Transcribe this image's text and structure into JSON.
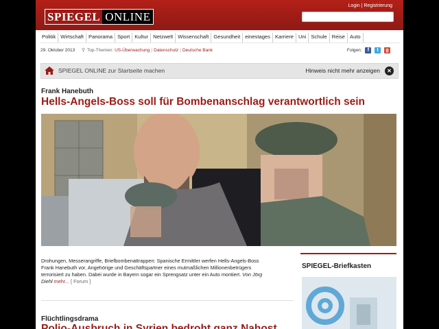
{
  "header": {
    "logo_part1": "SPIEGEL",
    "logo_part2": "ONLINE",
    "login": "Login",
    "register": "Registrierung",
    "brand_color": "#9b1b17"
  },
  "nav": {
    "items": [
      "Politik",
      "Wirtschaft",
      "Panorama",
      "Sport",
      "Kultur",
      "Netzwelt",
      "Wissenschaft",
      "Gesundheit",
      "einestages",
      "Karriere",
      "Uni",
      "Schule",
      "Reise",
      "Auto"
    ]
  },
  "datebar": {
    "date": "29. Oktober 2013",
    "top_label": "Top-Themen:",
    "topics": [
      "US-Überwachung",
      "Datenschutz",
      "Deutsche Bank"
    ],
    "follow_label": "Folgen:"
  },
  "startbar": {
    "text": "SPIEGEL ONLINE zur Startseite machen",
    "hint": "Hinweis nicht mehr anzeigen"
  },
  "article": {
    "kicker": "Frank Hanebuth",
    "headline": "Hells-Angels-Boss soll für Bombenanschlag verantwortlich sein",
    "teaser_line1": "Drohungen, Messerangriffe, Briefbombenattrappen: Spanische Ermittler werfen Hells-Angels-Boss",
    "teaser_line2": "Frank Hanebuth vor, Angehörige und Geschäftspartner eines mutmaßlichen Millionenbetrügers",
    "teaser_line3": "terrorisiert zu haben. Dabei wurde in Bayern sogar ein Sprengsatz unter ein Auto montiert.",
    "author": "Von Jörg",
    "author2": "Diehl",
    "more": "mehr...",
    "forum": "[ Forum ]"
  },
  "article2": {
    "kicker": "Flüchtlingsdrama",
    "headline": "Polio-Ausbruch in Syrien bedroht ganz Nahost"
  },
  "sidebar": {
    "title": "SPIEGEL-Briefkasten"
  },
  "icons": {
    "close": "close-icon",
    "home": "home-icon",
    "facebook": "facebook-icon",
    "twitter": "twitter-icon",
    "googleplus": "googleplus-icon",
    "top_topics": "pin-icon"
  }
}
